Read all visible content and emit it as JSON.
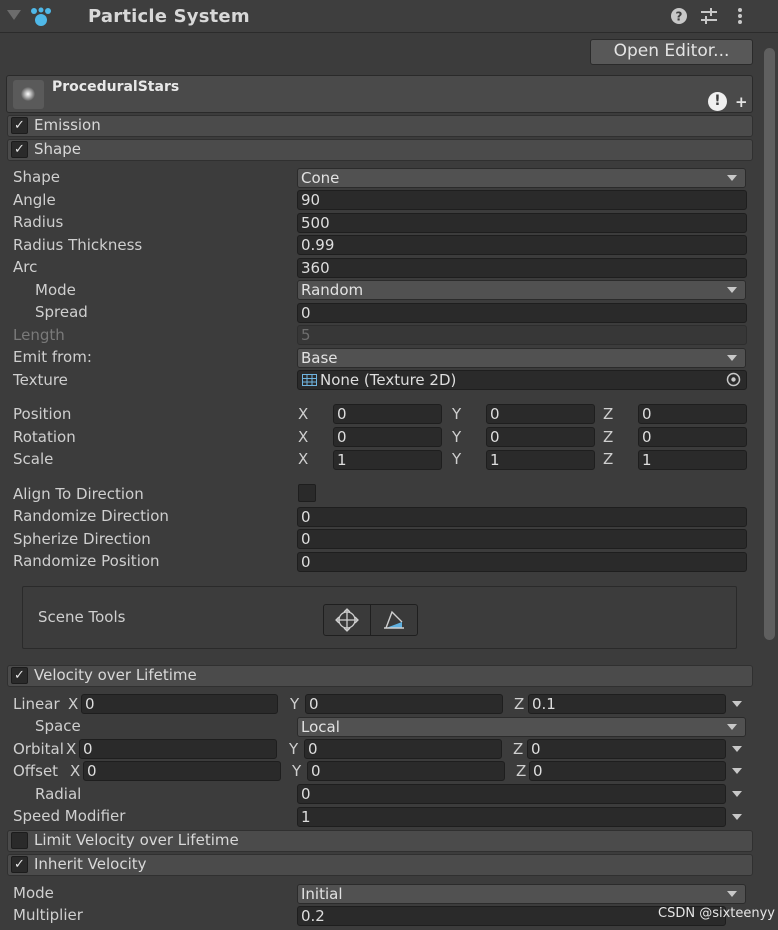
{
  "header": {
    "title": "Particle System",
    "icons": [
      "help-icon",
      "settings-sliders-icon",
      "more-vert-icon"
    ]
  },
  "open_editor_label": "Open Editor...",
  "particle_system": {
    "name": "ProceduralStars",
    "warning_glyph": "!",
    "add_glyph": "+"
  },
  "modules": {
    "emission": {
      "label": "Emission",
      "checked": true
    },
    "shape": {
      "label": "Shape",
      "checked": true
    },
    "velocity": {
      "label": "Velocity over Lifetime",
      "checked": true
    },
    "limit_velocity": {
      "label": "Limit Velocity over Lifetime",
      "checked": false
    },
    "inherit_velocity": {
      "label": "Inherit Velocity",
      "checked": true
    }
  },
  "check_glyph": "✓",
  "shape": {
    "shape": {
      "label": "Shape",
      "value": "Cone"
    },
    "angle": {
      "label": "Angle",
      "value": "90"
    },
    "radius": {
      "label": "Radius",
      "value": "500"
    },
    "radius_thickness": {
      "label": "Radius Thickness",
      "value": "0.99"
    },
    "arc": {
      "label": "Arc",
      "value": "360"
    },
    "mode": {
      "label": "Mode",
      "value": "Random"
    },
    "spread": {
      "label": "Spread",
      "value": "0"
    },
    "length": {
      "label": "Length",
      "value": "5"
    },
    "emit_from": {
      "label": "Emit from:",
      "value": "Base"
    },
    "texture": {
      "label": "Texture",
      "value": "None (Texture 2D)"
    },
    "position": {
      "label": "Position",
      "x": "0",
      "y": "0",
      "z": "0"
    },
    "rotation": {
      "label": "Rotation",
      "x": "0",
      "y": "0",
      "z": "0"
    },
    "scale": {
      "label": "Scale",
      "x": "1",
      "y": "1",
      "z": "1"
    },
    "align_to_direction": {
      "label": "Align To Direction",
      "checked": false
    },
    "randomize_direction": {
      "label": "Randomize Direction",
      "value": "0"
    },
    "spherize_direction": {
      "label": "Spherize Direction",
      "value": "0"
    },
    "randomize_position": {
      "label": "Randomize Position",
      "value": "0"
    },
    "scene_tools": {
      "label": "Scene Tools"
    }
  },
  "axes": {
    "x": "X",
    "y": "Y",
    "z": "Z"
  },
  "velocity": {
    "linear": {
      "label": "Linear",
      "x": "0",
      "y": "0",
      "z": "0.1"
    },
    "space": {
      "label": "Space",
      "value": "Local"
    },
    "orbital": {
      "label": "Orbital",
      "x": "0",
      "y": "0",
      "z": "0"
    },
    "offset": {
      "label": "Offset",
      "x": "0",
      "y": "0",
      "z": "0"
    },
    "radial": {
      "label": "Radial",
      "value": "0"
    },
    "speed_modifier": {
      "label": "Speed Modifier",
      "value": "1"
    }
  },
  "inherit": {
    "mode": {
      "label": "Mode",
      "value": "Initial"
    },
    "multiplier": {
      "label": "Multiplier",
      "value": "0.2"
    }
  },
  "watermark": "CSDN @sixteenyy"
}
